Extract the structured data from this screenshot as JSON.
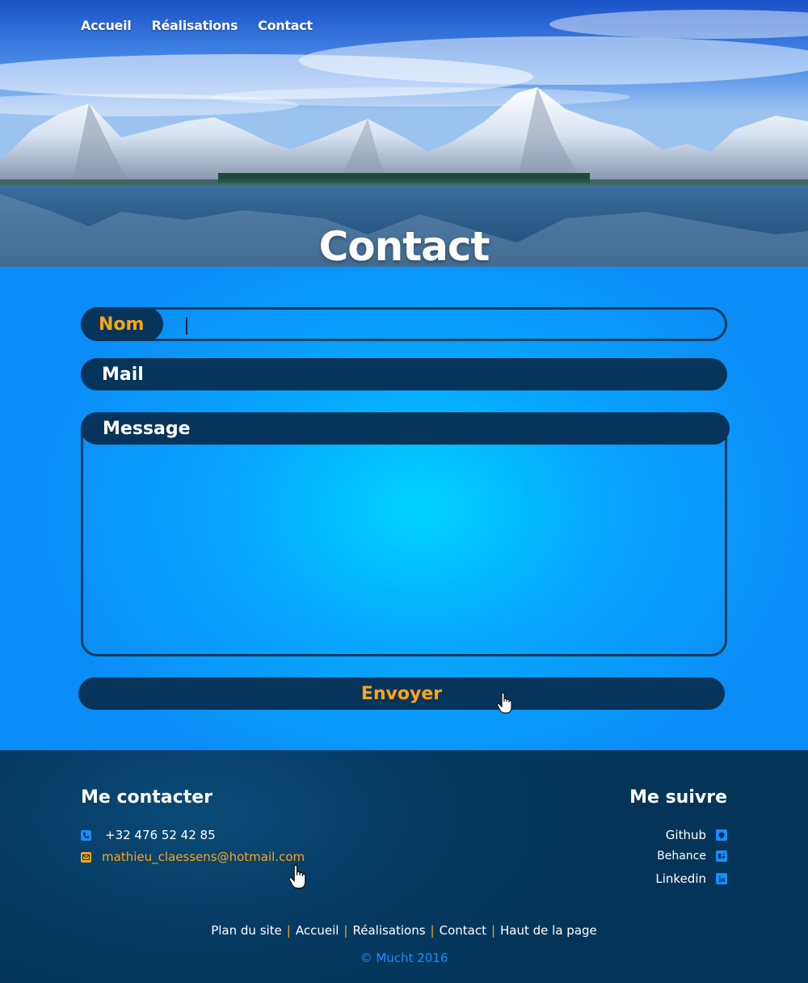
{
  "nav": {
    "items": [
      {
        "label": "Accueil"
      },
      {
        "label": "Réalisations"
      },
      {
        "label": "Contact"
      }
    ]
  },
  "hero": {
    "title": "Contact"
  },
  "form": {
    "nom_label": "Nom",
    "nom_value": "",
    "mail_label": "Mail",
    "mail_value": "",
    "message_label": "Message",
    "message_value": "",
    "submit_label": "Envoyer"
  },
  "footer": {
    "contact_heading": "Me contacter",
    "phone": "+32 476 52 42 85",
    "email": "mathieu_claessens@hotmail.com",
    "follow_heading": "Me suivre",
    "social": [
      {
        "label": "Github",
        "icon": "github-icon"
      },
      {
        "label": "Behance",
        "icon": "behance-icon"
      },
      {
        "label": "Linkedin",
        "icon": "linkedin-icon"
      }
    ],
    "links": [
      {
        "label": "Plan du site"
      },
      {
        "label": "Accueil"
      },
      {
        "label": "Réalisations"
      },
      {
        "label": "Contact"
      },
      {
        "label": "Haut de la page"
      }
    ],
    "separator": "|",
    "copyright": "© Mucht 2016"
  },
  "colors": {
    "accent": "#ffa514",
    "dark_blue": "#07345a",
    "bright_blue": "#0b8df7",
    "link_blue": "#1a8cff"
  }
}
